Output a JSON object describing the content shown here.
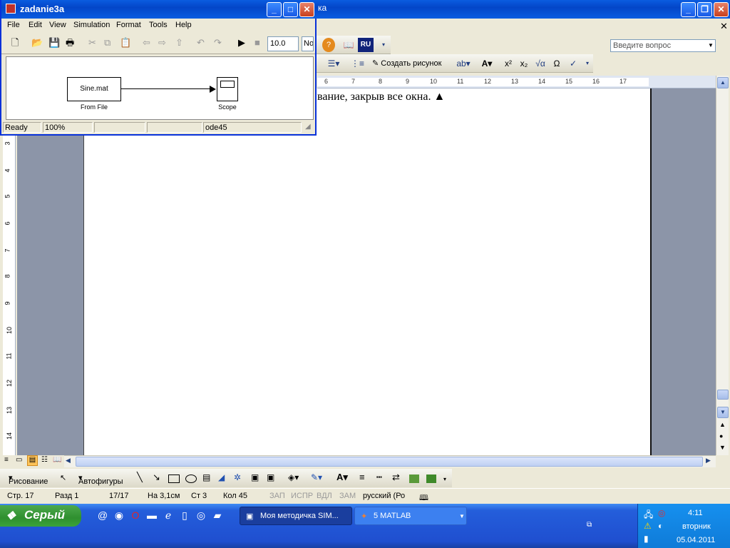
{
  "word": {
    "title_fragment": "ка",
    "question_placeholder": "Введите вопрос",
    "lang_badge": "RU",
    "create_drawing": "Создать рисунок",
    "doc_text": "вание, закрыв все окна. ▲",
    "ruler_h": [
      "6",
      "7",
      "8",
      "9",
      "10",
      "11",
      "12",
      "13",
      "14",
      "15",
      "16",
      "17"
    ],
    "ruler_v": [
      "3",
      "4",
      "5",
      "6",
      "7",
      "8",
      "9",
      "10",
      "11",
      "12",
      "13",
      "14"
    ],
    "draw_menu": "Рисование",
    "autoshapes": "Автофигуры",
    "status": {
      "page": "Стр. 17",
      "section": "Разд 1",
      "pages": "17/17",
      "at": "На 3,1см",
      "line": "Ст 3",
      "col": "Кол 45",
      "rec": "ЗАП",
      "trk": "ИСПР",
      "ext": "ВДЛ",
      "ovr": "ЗАМ",
      "lang": "русский (Ро"
    }
  },
  "simulink": {
    "title": "zadanie3a",
    "menu": [
      "File",
      "Edit",
      "View",
      "Simulation",
      "Format",
      "Tools",
      "Help"
    ],
    "stop_time": "10.0",
    "solver_mode": "No",
    "blocks": {
      "from_file_text": "Sine.mat",
      "from_file_label": "From File",
      "scope_label": "Scope"
    },
    "status": {
      "state": "Ready",
      "zoom": "100%",
      "solver": "ode45"
    }
  },
  "taskbar": {
    "start_label": "Серый",
    "tasks": [
      {
        "label": "Моя методичка SIM..."
      },
      {
        "label": "5 MATLAB"
      }
    ],
    "clock": {
      "time": "4:11",
      "day": "вторник",
      "date": "05.04.2011"
    }
  },
  "colors": {
    "titlebar": "#0a5ce0",
    "taskbar": "#245edb",
    "start": "#2f8f2f",
    "doc_gray": "#8c95a8"
  }
}
